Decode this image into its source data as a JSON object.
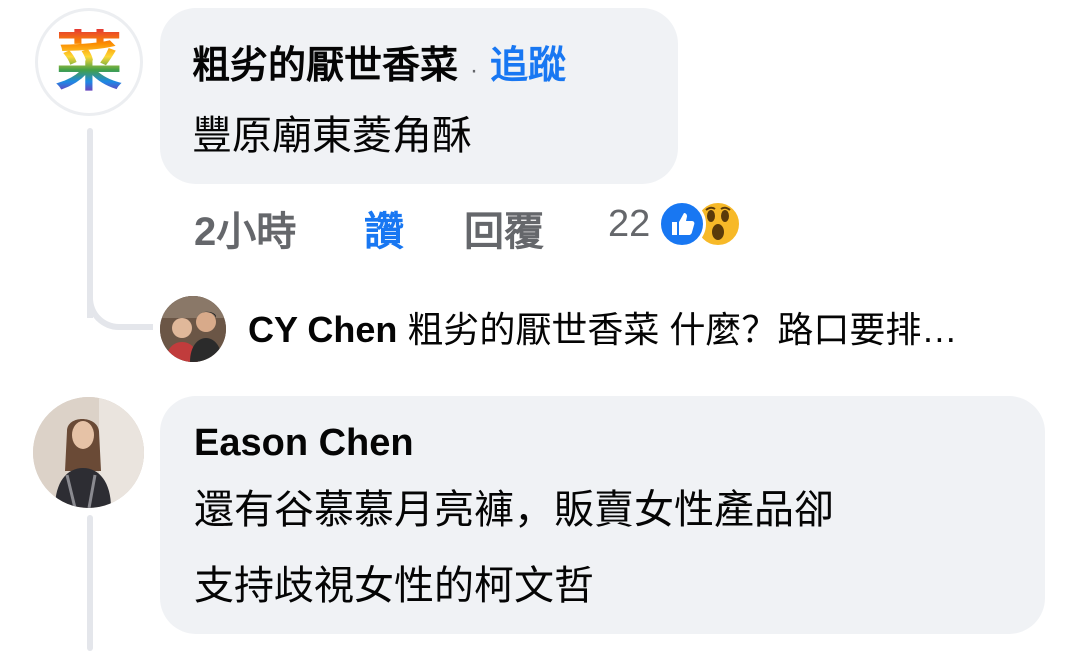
{
  "comments": [
    {
      "author": "粗劣的厭世香菜",
      "separator": "·",
      "follow_label": "追蹤",
      "text": "豐原廟東菱角酥",
      "avatar_glyph": "菜",
      "time": "2小時",
      "like_label": "讚",
      "reply_label": "回覆",
      "reaction_count": "22",
      "reaction_icons": [
        "like-icon",
        "wow-icon"
      ]
    },
    {
      "author": "Eason Chen",
      "text_lines": [
        "還有谷慕慕月亮褲，販賣女性產品卻",
        "支持歧視女性的柯文哲"
      ]
    }
  ],
  "reply_preview": {
    "author": "CY Chen",
    "text": "粗劣的厭世香菜 什麼？路口要排…"
  },
  "colors": {
    "bubble": "#f0f2f5",
    "accent": "#1877f2",
    "muted": "#65676b",
    "wow": "#f7b928"
  }
}
